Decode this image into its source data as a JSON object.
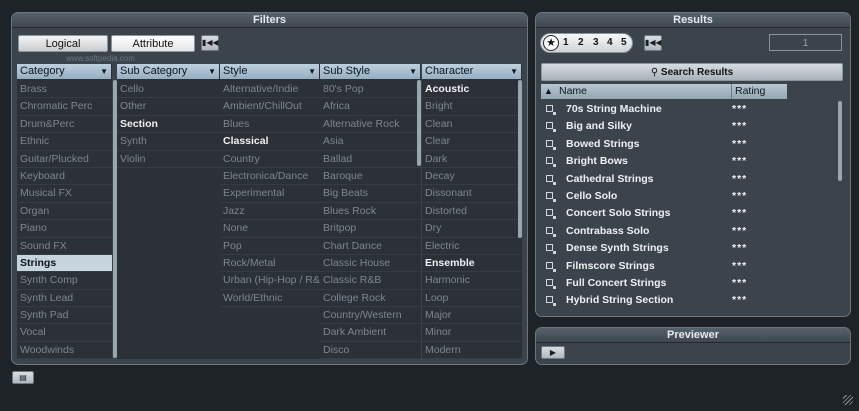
{
  "filters": {
    "title": "Filters",
    "logical_label": "Logical",
    "attribute_label": "Attribute",
    "reset_icon": "rewind-icon",
    "columns": [
      {
        "header": "Category",
        "items": [
          {
            "t": "Brass"
          },
          {
            "t": "Chromatic Perc"
          },
          {
            "t": "Drum&Perc"
          },
          {
            "t": "Ethnic"
          },
          {
            "t": "Guitar/Plucked"
          },
          {
            "t": "Keyboard"
          },
          {
            "t": "Musical FX"
          },
          {
            "t": "Organ"
          },
          {
            "t": "Piano"
          },
          {
            "t": "Sound FX"
          },
          {
            "t": "Strings",
            "s": "sel"
          },
          {
            "t": "Synth Comp"
          },
          {
            "t": "Synth Lead"
          },
          {
            "t": "Synth Pad"
          },
          {
            "t": "Vocal"
          },
          {
            "t": "Woodwinds"
          }
        ]
      },
      {
        "header": "Sub Category",
        "items": [
          {
            "t": "Cello"
          },
          {
            "t": "Other"
          },
          {
            "t": "Section",
            "s": "bold"
          },
          {
            "t": "Synth"
          },
          {
            "t": "Violin"
          }
        ]
      },
      {
        "header": "Style",
        "items": [
          {
            "t": "Alternative/Indie"
          },
          {
            "t": "Ambient/ChillOut"
          },
          {
            "t": "Blues"
          },
          {
            "t": "Classical",
            "s": "bold"
          },
          {
            "t": "Country"
          },
          {
            "t": "Electronica/Dance"
          },
          {
            "t": "Experimental"
          },
          {
            "t": "Jazz"
          },
          {
            "t": "None"
          },
          {
            "t": "Pop"
          },
          {
            "t": "Rock/Metal"
          },
          {
            "t": "Urban (Hip-Hop / R&B)"
          },
          {
            "t": "World/Ethnic"
          }
        ]
      },
      {
        "header": "Sub Style",
        "items": [
          {
            "t": "80's Pop"
          },
          {
            "t": "Africa"
          },
          {
            "t": "Alternative Rock"
          },
          {
            "t": "Asia"
          },
          {
            "t": "Ballad"
          },
          {
            "t": "Baroque"
          },
          {
            "t": "Big Beats"
          },
          {
            "t": "Blues Rock"
          },
          {
            "t": "Britpop"
          },
          {
            "t": "Chart Dance"
          },
          {
            "t": "Classic House"
          },
          {
            "t": "Classic R&B"
          },
          {
            "t": "College Rock"
          },
          {
            "t": "Country/Western"
          },
          {
            "t": "Dark Ambient"
          },
          {
            "t": "Disco"
          }
        ]
      },
      {
        "header": "Character",
        "items": [
          {
            "t": "Acoustic",
            "s": "bold"
          },
          {
            "t": "Bright"
          },
          {
            "t": "Clean"
          },
          {
            "t": "Clear"
          },
          {
            "t": "Dark"
          },
          {
            "t": "Decay"
          },
          {
            "t": "Dissonant"
          },
          {
            "t": "Distorted"
          },
          {
            "t": "Dry"
          },
          {
            "t": "Electric"
          },
          {
            "t": "Ensemble",
            "s": "bold"
          },
          {
            "t": "Harmonic"
          },
          {
            "t": "Loop"
          },
          {
            "t": "Major"
          },
          {
            "t": "Minor"
          },
          {
            "t": "Modern"
          }
        ]
      }
    ]
  },
  "results": {
    "title": "Results",
    "rating_filter": [
      "1",
      "2",
      "3",
      "4",
      "5"
    ],
    "rating_star": "★",
    "count": "1",
    "search_label": "Search Results",
    "col_name": "Name",
    "col_rating": "Rating",
    "sort_arrow": "▲",
    "rows": [
      {
        "name": "70s String Machine",
        "rating": "***"
      },
      {
        "name": "Big and Silky",
        "rating": "***"
      },
      {
        "name": "Bowed Strings",
        "rating": "***"
      },
      {
        "name": "Bright Bows",
        "rating": "***"
      },
      {
        "name": "Cathedral Strings",
        "rating": "***"
      },
      {
        "name": "Cello Solo",
        "rating": "***"
      },
      {
        "name": "Concert Solo Strings",
        "rating": "***"
      },
      {
        "name": "Contrabass Solo",
        "rating": "***"
      },
      {
        "name": "Dense Synth Strings",
        "rating": "***"
      },
      {
        "name": "Filmscore Strings",
        "rating": "***"
      },
      {
        "name": "Full Concert Strings",
        "rating": "***"
      },
      {
        "name": "Hybrid String Section",
        "rating": "***"
      }
    ]
  },
  "previewer": {
    "title": "Previewer"
  },
  "watermark": "www.softpedia.com"
}
